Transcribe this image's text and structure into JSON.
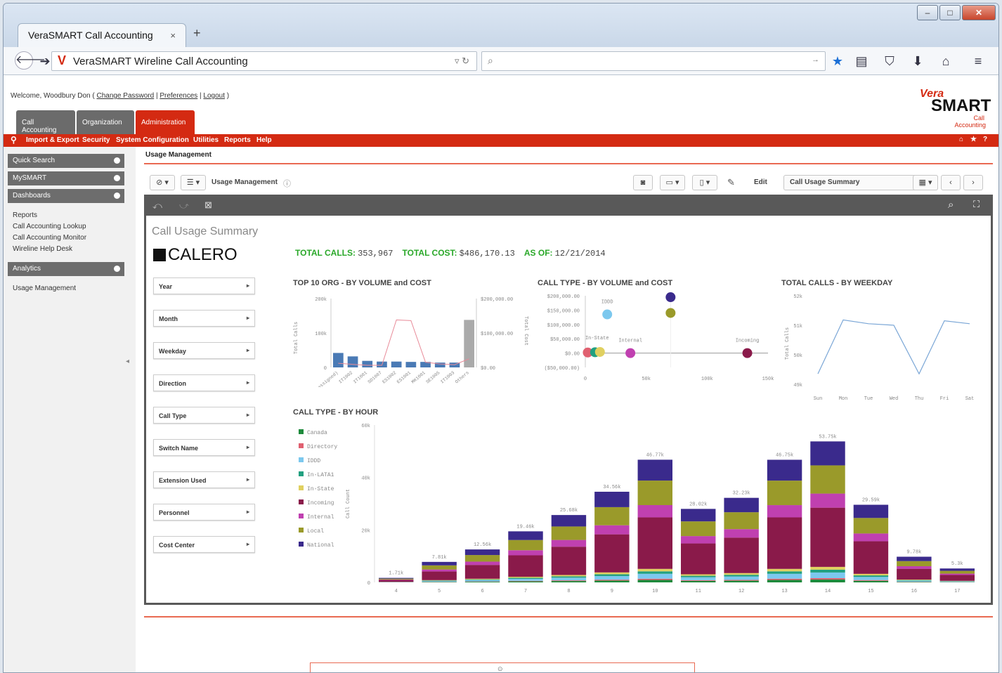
{
  "browser": {
    "tab_title": "VeraSMART Call Accounting",
    "tab_close": "×",
    "new_tab": "+",
    "url_text": "VeraSMART Wireline Call Accounting",
    "win_min": "–",
    "win_max": "□",
    "win_close": "✕"
  },
  "header": {
    "welcome_prefix": "Welcome, Woodbury Don ( ",
    "change_password": "Change Password",
    "sep1": " | ",
    "preferences": "Preferences",
    "sep2": " | ",
    "logout": "Logout",
    "welcome_suffix": " )",
    "logo_vera": "Vera",
    "logo_smart": "SMART",
    "logo_sub1": "Call",
    "logo_sub2": "Accounting"
  },
  "app_tabs": [
    "Call Accounting",
    "Organization",
    "Administration"
  ],
  "menu": [
    "Import & Export",
    "Security",
    "System Configuration",
    "Utilities",
    "Reports",
    "Help"
  ],
  "sidebar": {
    "quick_search": "Quick Search",
    "mysmart": "MySMART",
    "dashboards": "Dashboards",
    "dash_links": [
      "Reports",
      "Call Accounting Lookup",
      "Call Accounting Monitor",
      "Wireline Help Desk"
    ],
    "analytics": "Analytics",
    "analytics_links": [
      "Usage Management"
    ]
  },
  "page_title": "Usage Management",
  "toolbar": {
    "app_name": "Usage Management",
    "edit": "Edit",
    "sheet_name": "Call Usage Summary"
  },
  "sheet": {
    "title": "Call Usage Summary",
    "brand": "CALERO",
    "kpi_calls_label": "TOTAL CALLS:",
    "kpi_calls_value": "353,967",
    "kpi_cost_label": "TOTAL COST:",
    "kpi_cost_value": "$486,170.13",
    "kpi_asof_label": "AS OF:",
    "kpi_asof_value": "12/21/2014"
  },
  "filters": [
    "Year",
    "Month",
    "Weekday",
    "Direction",
    "Call Type",
    "Switch Name",
    "Extension Used",
    "Personnel",
    "Cost Center"
  ],
  "colors": {
    "red": "#d42a12",
    "green": "#2aa829",
    "bar_blue": "#4a7ab5"
  },
  "chart_data": [
    {
      "type": "bar",
      "title": "TOP 10 ORG - BY VOLUME and COST",
      "categories": [
        "(Unassigned)",
        "IT1002",
        "IT1001",
        "SD1007",
        "ES1002",
        "ES1001",
        "MK1001",
        "SE1005",
        "IT1003",
        "Others"
      ],
      "series": [
        {
          "name": "Total Calls",
          "values": [
            42,
            32,
            19,
            17,
            17,
            16,
            16,
            14,
            14,
            138
          ]
        },
        {
          "name": "Total Cost",
          "values": [
            12000,
            9000,
            6000,
            6000,
            138000,
            136000,
            15000,
            10000,
            8000,
            25000
          ]
        }
      ],
      "ylabel": "Total Calls",
      "y2label": "Total Cost",
      "ylim": [
        0,
        200
      ],
      "yticks": [
        "0",
        "100k",
        "200k"
      ],
      "y2ticks": [
        "$0.00",
        "$100,000.00",
        "$200,000.00"
      ]
    },
    {
      "type": "scatter",
      "title": "CALL TYPE - BY VOLUME and COST",
      "ylabel": "Total Cost",
      "xlim": [
        0,
        150
      ],
      "xticks": [
        "0",
        "50k",
        "100k",
        "150k"
      ],
      "yticks": [
        "($50,000.00)",
        "$0.00",
        "$50,000.00",
        "$100,000.00",
        "$150,000.00",
        "$200,000.00"
      ],
      "points": [
        {
          "label": "National",
          "x": 70,
          "y": 195000,
          "color": "#3a2a8c"
        },
        {
          "label": "Local",
          "x": 70,
          "y": 140000,
          "color": "#9a9a2a"
        },
        {
          "label": "IDDD",
          "x": 18,
          "y": 135000,
          "color": "#7cc8ee"
        },
        {
          "label": "Directory",
          "x": 2,
          "y": 2000,
          "color": "#e06070"
        },
        {
          "label": "In-LATA1",
          "x": 8,
          "y": 3000,
          "color": "#22a080"
        },
        {
          "label": "In-State",
          "x": 12,
          "y": 4000,
          "color": "#e0d060"
        },
        {
          "label": "Internal",
          "x": 37,
          "y": 0,
          "color": "#c040b0"
        },
        {
          "label": "Incoming",
          "x": 133,
          "y": 0,
          "color": "#8a1a4a"
        }
      ],
      "labels_shown": [
        "IDDD",
        "In-State",
        "Internal",
        "Incoming"
      ]
    },
    {
      "type": "line",
      "title": "TOTAL CALLS - BY WEEKDAY",
      "ylabel": "Total Calls",
      "categories": [
        "Sun",
        "Mon",
        "Tue",
        "Wed",
        "Thu",
        "Fri",
        "Sat"
      ],
      "values": [
        49350,
        51180,
        51050,
        51000,
        49350,
        51150,
        51050
      ],
      "ylim": [
        48900,
        52000
      ],
      "yticks": [
        "49k",
        "50k",
        "51k",
        "52k"
      ]
    },
    {
      "type": "bar",
      "title": "CALL TYPE - BY HOUR",
      "ylabel": "Call Count",
      "categories": [
        "4",
        "5",
        "6",
        "7",
        "8",
        "9",
        "10",
        "11",
        "12",
        "13",
        "14",
        "15",
        "16",
        "17"
      ],
      "totals_labels": [
        "1.71k",
        "7.81k",
        "12.56k",
        "19.46k",
        "25.68k",
        "34.56k",
        "46.77k",
        "28.02k",
        "32.23k",
        "46.75k",
        "53.75k",
        "29.59k",
        "9.78k",
        "5.3k"
      ],
      "totals": [
        1710,
        7810,
        12560,
        19460,
        25680,
        34560,
        46770,
        28020,
        32230,
        46750,
        53750,
        29590,
        9780,
        5300
      ],
      "ylim": [
        0,
        60000
      ],
      "yticks": [
        "0",
        "20k",
        "40k",
        "60k"
      ],
      "legend": [
        "Canada",
        "Directory",
        "IDDD",
        "In-LATA1",
        "In-State",
        "Incoming",
        "Internal",
        "Local",
        "National"
      ],
      "legend_colors": [
        "#1e8a3c",
        "#e06070",
        "#7cc8ee",
        "#22a080",
        "#e0d060",
        "#8a1a4a",
        "#c040b0",
        "#9a9a2a",
        "#3a2a8c"
      ],
      "shares": [
        0.02,
        0.01,
        0.04,
        0.02,
        0.02,
        0.42,
        0.1,
        0.2,
        0.17
      ]
    }
  ]
}
